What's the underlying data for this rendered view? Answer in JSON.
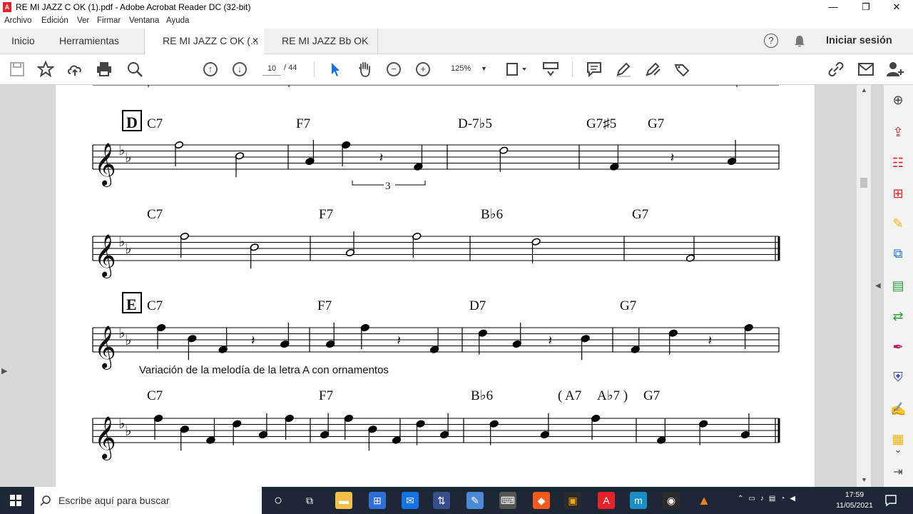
{
  "window": {
    "title": "RE MI JAZZ C OK (1).pdf - Adobe Acrobat Reader DC (32-bit)",
    "minimize": "—",
    "restore": "❐",
    "close": "✕"
  },
  "menu": [
    "Archivo",
    "Edición",
    "Ver",
    "Firmar",
    "Ventana",
    "Ayuda"
  ],
  "tabs": {
    "home": "Inicio",
    "tools": "Herramientas",
    "doc1": "RE MI JAZZ C OK (...",
    "doc2": "RE MI JAZZ Bb OK ...",
    "close": "✕"
  },
  "account": {
    "signin": "Iniciar sesión",
    "help": "?"
  },
  "toolbar": {
    "page_current": "10",
    "page_total": "/ 44",
    "zoom": "125%"
  },
  "score": {
    "rows": [
      {
        "rehearsal": "D",
        "chords": [
          "C7",
          "F7",
          "D-7♭5",
          "G7♯5",
          "G7"
        ],
        "triplet": "3"
      },
      {
        "rehearsal": "",
        "chords": [
          "C7",
          "F7",
          "B♭6",
          "G7"
        ]
      },
      {
        "rehearsal": "E",
        "chords": [
          "C7",
          "F7",
          "D7",
          "G7"
        ]
      },
      {
        "rehearsal": "",
        "chords": [
          "C7",
          "F7",
          "B♭6",
          "( A7",
          "A♭7 )",
          "G7"
        ]
      }
    ],
    "caption": "Variación de la melodía de la letra A con ornamentos"
  },
  "taskbar": {
    "search_placeholder": "Escribe aquí para buscar",
    "time": "17:59",
    "date": "11/05/2021"
  },
  "colors": {
    "acrobat_red": "#e8222a",
    "taskbar": "#1d2736",
    "accent_blue": "#1473e6"
  }
}
